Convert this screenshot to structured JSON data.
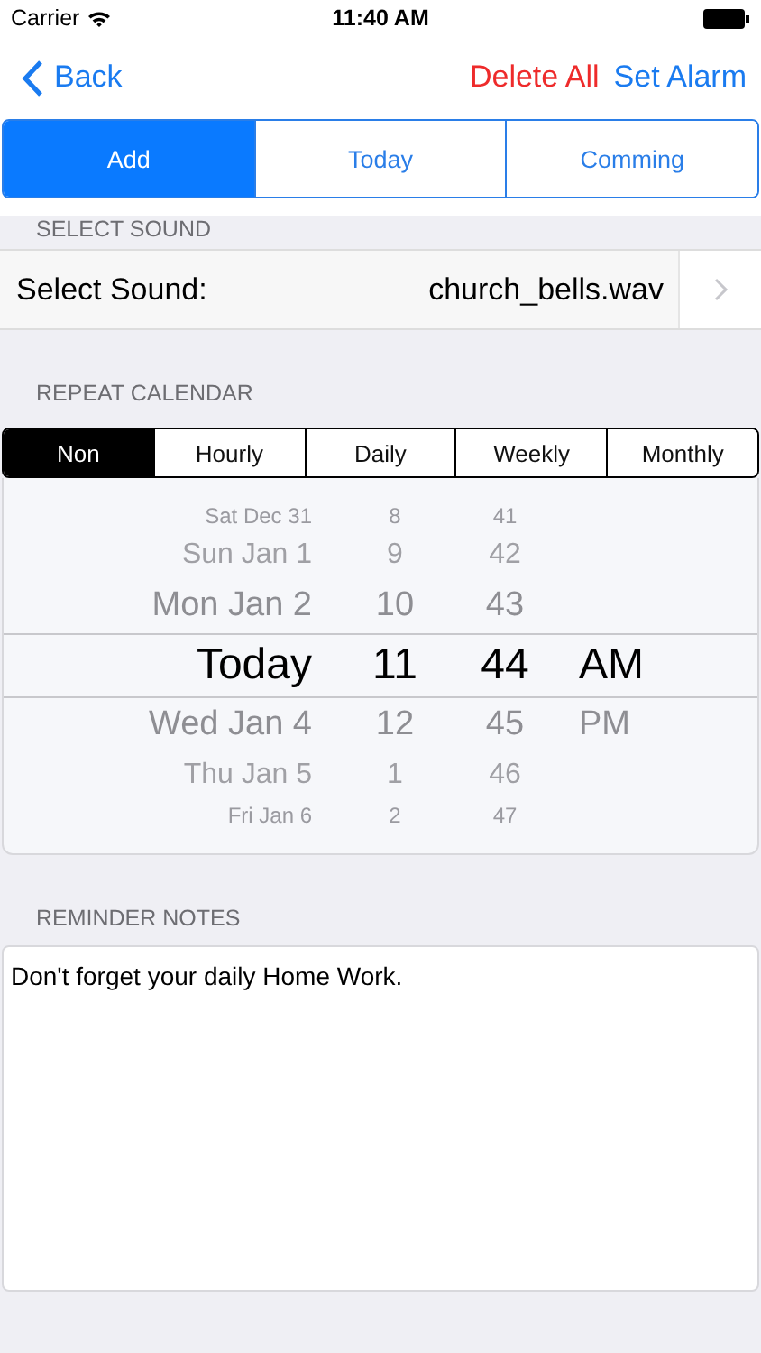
{
  "status_bar": {
    "carrier": "Carrier",
    "time": "11:40 AM"
  },
  "nav": {
    "back": "Back",
    "actions": [
      {
        "label": "Delete All",
        "kind": "destructive"
      },
      {
        "label": "Set Alarm",
        "kind": "normal"
      }
    ]
  },
  "tabs": [
    {
      "label": "Add",
      "selected": true
    },
    {
      "label": "Today",
      "selected": false
    },
    {
      "label": "Comming",
      "selected": false
    }
  ],
  "sound_section": {
    "header": "SELECT SOUND",
    "label": "Select Sound:",
    "value": "church_bells.wav"
  },
  "repeat_section": {
    "header": "REPEAT CALENDAR",
    "options": [
      {
        "label": "Non",
        "selected": true
      },
      {
        "label": "Hourly",
        "selected": false
      },
      {
        "label": "Daily",
        "selected": false
      },
      {
        "label": "Weekly",
        "selected": false
      },
      {
        "label": "Monthly",
        "selected": false
      }
    ]
  },
  "picker": {
    "rows": [
      {
        "date": "Sat Dec 31",
        "hour": "8",
        "minute": "41",
        "selected": false
      },
      {
        "date": "Sun Jan 1",
        "hour": "9",
        "minute": "42",
        "selected": false
      },
      {
        "date": "Mon Jan 2",
        "hour": "10",
        "minute": "43",
        "selected": false
      },
      {
        "date": "Today",
        "hour": "11",
        "minute": "44",
        "period": "AM",
        "selected": true
      },
      {
        "date": "Wed Jan 4",
        "hour": "12",
        "minute": "45",
        "period": "PM",
        "selected": false
      },
      {
        "date": "Thu Jan 5",
        "hour": "1",
        "minute": "46",
        "selected": false
      },
      {
        "date": "Fri Jan 6",
        "hour": "2",
        "minute": "47",
        "selected": false
      }
    ]
  },
  "notes_section": {
    "header": "REMINDER NOTES",
    "text": "Don't forget your daily Home Work."
  }
}
